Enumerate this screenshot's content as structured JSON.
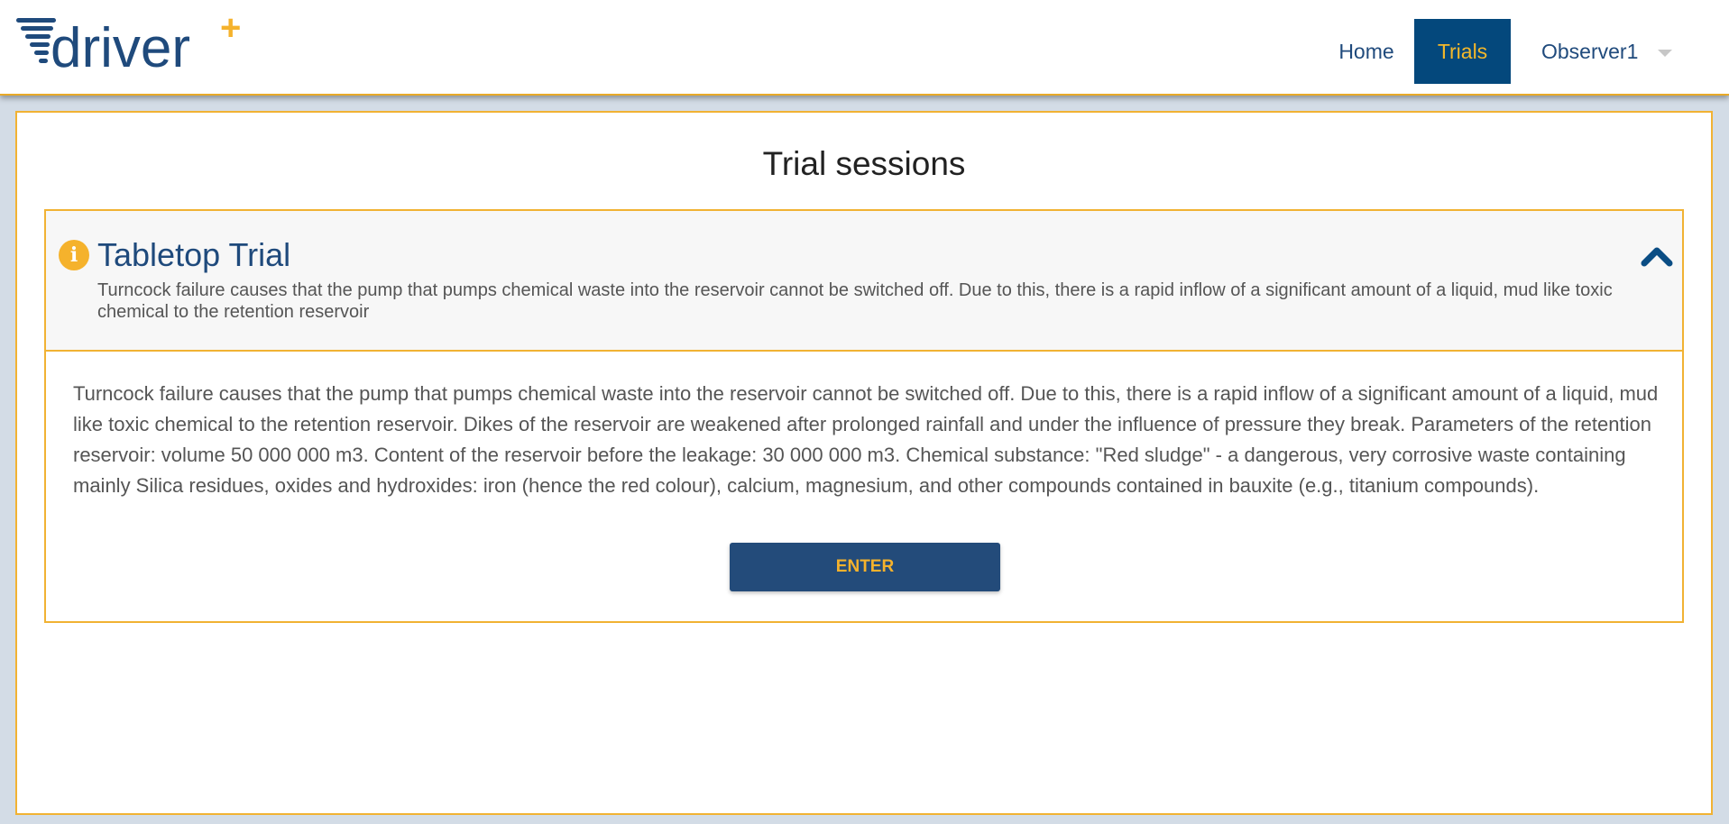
{
  "app": {
    "logo_text": "driver",
    "logo_plus": "+"
  },
  "nav": {
    "home_label": "Home",
    "trials_label": "Trials",
    "user_label": "Observer1"
  },
  "page": {
    "title": "Trial sessions"
  },
  "trial": {
    "icon": "info-icon",
    "title": "Tabletop Trial",
    "summary": "Turncock failure causes that the pump that pumps chemical waste into the reservoir cannot be switched off. Due to this, there is a rapid inflow of a significant amount of a liquid, mud like toxic chemical to the retention reservoir",
    "description": "Turncock failure causes that the pump that pumps chemical waste into the reservoir cannot be switched off. Due to this, there is a rapid inflow of a significant amount of a liquid, mud like toxic chemical to the retention reservoir. Dikes of the reservoir are weakened after prolonged rainfall and under the influence of pressure they break. Parameters of the retention reservoir: volume 50 000 000 m3. Content of the reservoir before the leakage: 30 000 000 m3. Chemical substance: \"Red sludge\" - a dangerous, very corrosive waste containing mainly Silica residues, oxides and hydroxides: iron (hence the red colour), calcium, magnesium, and other compounds contained in bauxite (e.g., titanium compounds).",
    "enter_label": "ENTER",
    "expanded": true
  },
  "colors": {
    "brand_blue": "#1f4a7c",
    "accent_yellow": "#f5b22c",
    "active_nav_bg": "#04487c",
    "border_yellow": "#f1b233"
  }
}
